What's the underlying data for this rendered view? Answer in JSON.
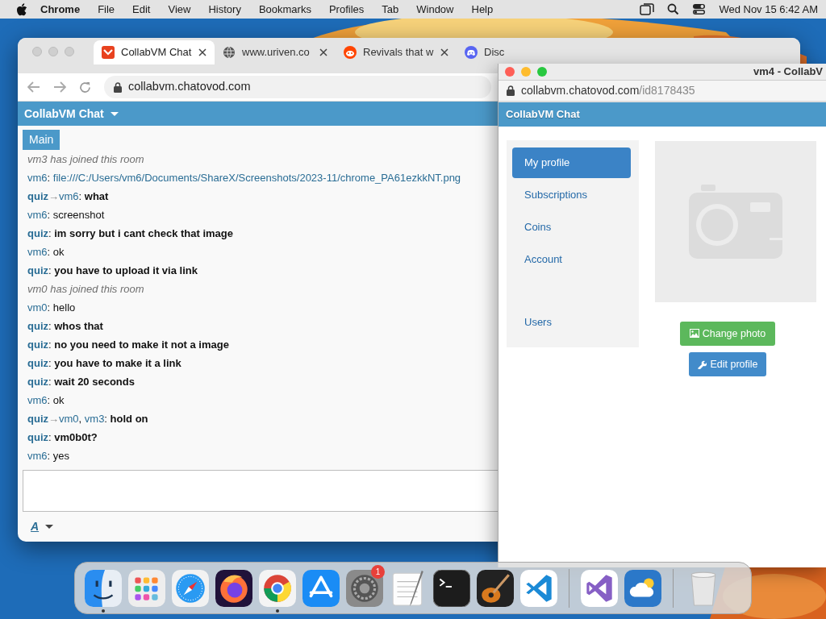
{
  "menu_bar": {
    "app": "Chrome",
    "menus": [
      "File",
      "Edit",
      "View",
      "History",
      "Bookmarks",
      "Profiles",
      "Tab",
      "Window",
      "Help"
    ],
    "clock": "Wed Nov 15  6:42 AM"
  },
  "browser": {
    "tabs": [
      {
        "kind": "collabvm",
        "title": "CollabVM Chat",
        "selected": true
      },
      {
        "kind": "globe",
        "title": "www.uriven.co",
        "selected": false
      },
      {
        "kind": "reddit",
        "title": "Revivals that w",
        "selected": false
      },
      {
        "kind": "discord",
        "title": "Disc",
        "selected": false
      }
    ],
    "url": "collabvm.chatovod.com",
    "page": {
      "brand": "CollabVM Chat",
      "room": "Main",
      "messages": [
        {
          "kind": "system",
          "text": "vm3 has joined this room"
        },
        {
          "kind": "link",
          "sender": "vm6",
          "sep": ":",
          "text": "file:///C:/Users/vm6/Documents/ShareX/Screenshots/2023-11/chrome_PA61ezkkNT.png",
          "bold": false
        },
        {
          "kind": "message",
          "sender": "quiz",
          "arrow": "→",
          "to": [
            {
              "name": "vm6"
            }
          ],
          "sep": ":",
          "text": "what",
          "bold": true
        },
        {
          "kind": "message",
          "sender": "vm6",
          "sep": ":",
          "text": "screenshot",
          "bold": false
        },
        {
          "kind": "message",
          "sender": "quiz",
          "sep": ":",
          "text": "im sorry but i cant check that image",
          "bold": true
        },
        {
          "kind": "message",
          "sender": "vm6",
          "sep": ":",
          "text": "ok",
          "bold": false
        },
        {
          "kind": "message",
          "sender": "quiz",
          "sep": ":",
          "text": "you have to upload it via link",
          "bold": true
        },
        {
          "kind": "system",
          "text": "vm0 has joined this room"
        },
        {
          "kind": "message",
          "sender": "vm0",
          "sep": ":",
          "text": "hello",
          "bold": false
        },
        {
          "kind": "message",
          "sender": "quiz",
          "sep": ":",
          "text": "whos that",
          "bold": true
        },
        {
          "kind": "message",
          "sender": "quiz",
          "sep": ":",
          "text": "no you need to make it not a image",
          "bold": true
        },
        {
          "kind": "message",
          "sender": "quiz",
          "sep": ":",
          "text": "you have to make it a link",
          "bold": true
        },
        {
          "kind": "message",
          "sender": "quiz",
          "sep": ":",
          "text": "wait 20 seconds",
          "bold": true
        },
        {
          "kind": "message",
          "sender": "vm6",
          "sep": ":",
          "text": "ok",
          "bold": false
        },
        {
          "kind": "message",
          "sender": "quiz",
          "arrow": "→",
          "to": [
            {
              "name": "vm0",
              "sep": ","
            },
            {
              "name": "vm3"
            }
          ],
          "sep": ":",
          "text": "hold on",
          "bold": true
        },
        {
          "kind": "message",
          "sender": "quiz",
          "sep": ":",
          "text": "vm0b0t?",
          "bold": true
        },
        {
          "kind": "message",
          "sender": "vm6",
          "sep": ":",
          "text": "yes",
          "bold": false
        }
      ],
      "format_button": "A"
    }
  },
  "popup": {
    "title": "vm4 - CollabV",
    "url_host": "collabvm.chatovod.com",
    "url_path": "/id8178435",
    "brand": "CollabVM Chat",
    "sidebar": {
      "items": [
        {
          "label": "My profile",
          "selected": true
        },
        {
          "label": "Subscriptions",
          "selected": false
        },
        {
          "label": "Coins",
          "selected": false
        },
        {
          "label": "Account",
          "selected": false
        }
      ],
      "footer_items": [
        {
          "label": "Users",
          "selected": false
        }
      ]
    },
    "buttons": [
      {
        "kind": "change_photo",
        "label": "Change photo"
      },
      {
        "kind": "edit_profile",
        "label": "Edit profile"
      }
    ]
  },
  "dock": {
    "items": [
      {
        "kind": "finder",
        "running": true
      },
      {
        "kind": "launchpad",
        "running": false
      },
      {
        "kind": "safari",
        "running": false
      },
      {
        "kind": "firefox",
        "running": false
      },
      {
        "kind": "chrome",
        "running": true
      },
      {
        "kind": "appstore",
        "running": false
      },
      {
        "kind": "settings",
        "running": false,
        "badge": "1"
      },
      {
        "kind": "textedit",
        "running": false
      },
      {
        "kind": "terminal",
        "running": false
      },
      {
        "kind": "garageband",
        "running": false
      },
      {
        "kind": "vscode",
        "running": false
      },
      {
        "kind": "separator"
      },
      {
        "kind": "visualstudio",
        "running": false
      },
      {
        "kind": "weather",
        "running": false
      },
      {
        "kind": "separator"
      },
      {
        "kind": "trash",
        "running": false
      }
    ]
  }
}
